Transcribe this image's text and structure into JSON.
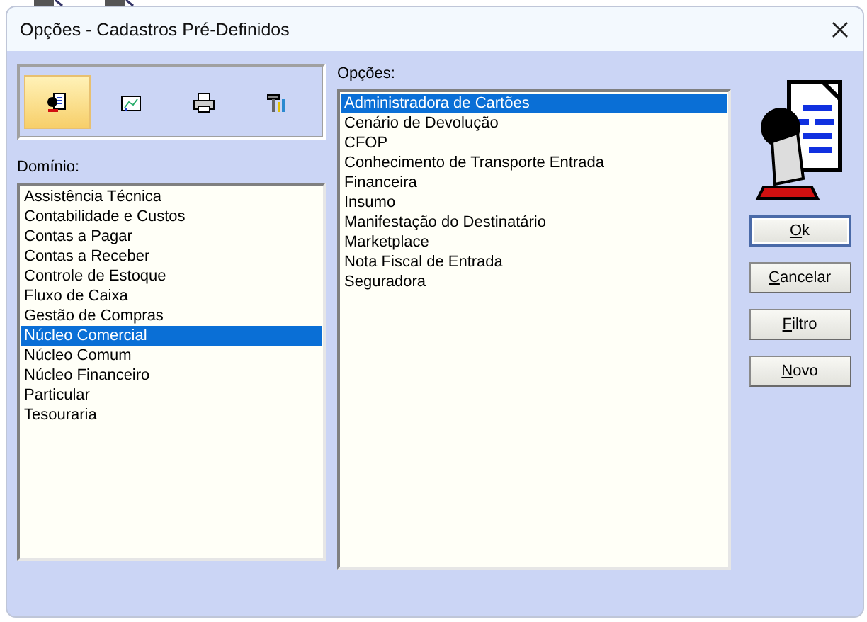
{
  "window": {
    "title": "Opções - Cadastros Pré-Definidos"
  },
  "toolbar": [
    {
      "kind": "person-document",
      "selected": true
    },
    {
      "kind": "chart",
      "selected": false
    },
    {
      "kind": "printer",
      "selected": false
    },
    {
      "kind": "tools",
      "selected": false
    }
  ],
  "domain": {
    "label": "Domínio:",
    "items": [
      {
        "label": "Assistência Técnica",
        "selected": false
      },
      {
        "label": "Contabilidade e Custos",
        "selected": false
      },
      {
        "label": "Contas a Pagar",
        "selected": false
      },
      {
        "label": "Contas a Receber",
        "selected": false
      },
      {
        "label": "Controle de Estoque",
        "selected": false
      },
      {
        "label": "Fluxo de Caixa",
        "selected": false
      },
      {
        "label": "Gestão de Compras",
        "selected": false
      },
      {
        "label": "Núcleo Comercial",
        "selected": true
      },
      {
        "label": "Núcleo Comum",
        "selected": false
      },
      {
        "label": "Núcleo Financeiro",
        "selected": false
      },
      {
        "label": "Particular",
        "selected": false
      },
      {
        "label": "Tesouraria",
        "selected": false
      }
    ]
  },
  "options": {
    "label": "Opções:",
    "items": [
      {
        "label": "Administradora de Cartões",
        "selected": true
      },
      {
        "label": "Cenário de Devolução",
        "selected": false
      },
      {
        "label": "CFOP",
        "selected": false
      },
      {
        "label": "Conhecimento de Transporte Entrada",
        "selected": false
      },
      {
        "label": "Financeira",
        "selected": false
      },
      {
        "label": "Insumo",
        "selected": false
      },
      {
        "label": "Manifestação do Destinatário",
        "selected": false
      },
      {
        "label": "Marketplace",
        "selected": false
      },
      {
        "label": "Nota Fiscal de Entrada",
        "selected": false
      },
      {
        "label": "Seguradora",
        "selected": false
      }
    ]
  },
  "buttons": [
    {
      "label": "Ok",
      "default": true
    },
    {
      "label": "Cancelar",
      "default": false
    },
    {
      "label": "Filtro",
      "default": false
    },
    {
      "label": "Novo",
      "default": false
    }
  ]
}
